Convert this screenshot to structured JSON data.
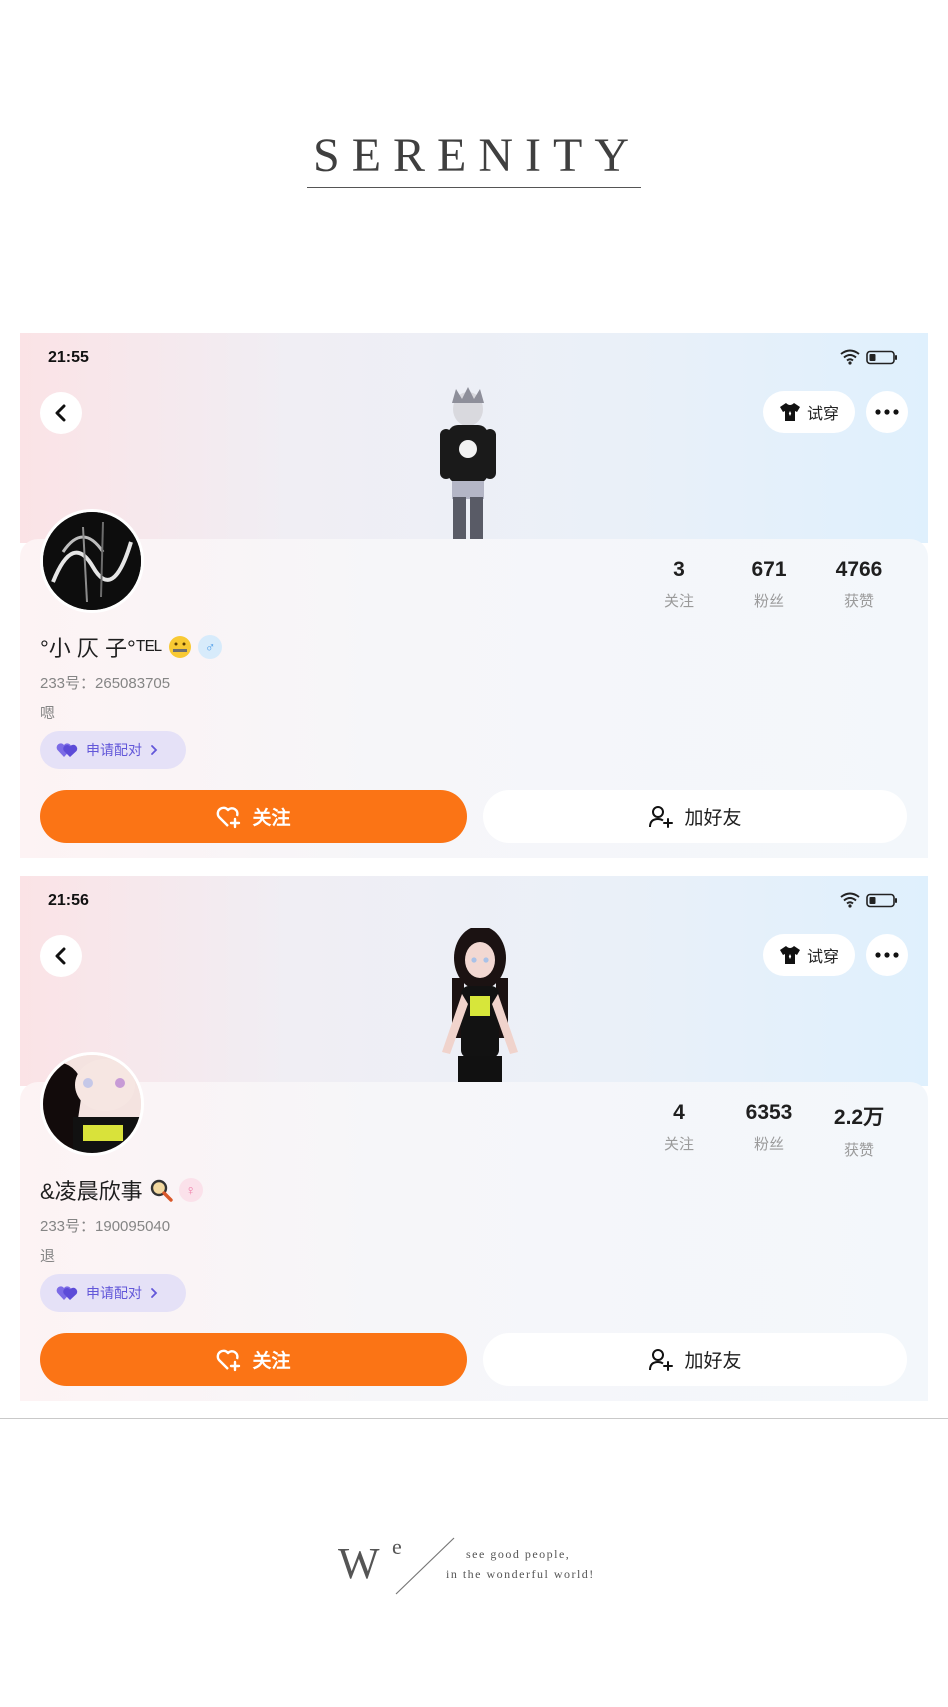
{
  "header_title": "SERENITY",
  "profiles": [
    {
      "status_time": "21:55",
      "tryon_label": "试穿",
      "stats": [
        {
          "value": "3",
          "label": "关注"
        },
        {
          "value": "671",
          "label": "粉丝"
        },
        {
          "value": "4766",
          "label": "获赞"
        }
      ],
      "username": "°小 仄 子°ᵀᴱᴸ",
      "gender": "♂",
      "account_id": "233号：265083705",
      "bio": "嗯",
      "pair_label": "申请配对",
      "follow_label": "关注",
      "add_friend_label": "加好友"
    },
    {
      "status_time": "21:56",
      "tryon_label": "试穿",
      "stats": [
        {
          "value": "4",
          "label": "关注"
        },
        {
          "value": "6353",
          "label": "粉丝"
        },
        {
          "value": "2.2万",
          "label": "获赞"
        }
      ],
      "username": "&凌晨欣事",
      "gender": "♀",
      "account_id": "233号：190095040",
      "bio": "退",
      "pair_label": "申请配对",
      "follow_label": "关注",
      "add_friend_label": "加好友"
    }
  ],
  "footer": {
    "letter_w": "W",
    "letter_e": "e",
    "line1": "see good people,",
    "line2": "in the wonderful world!"
  },
  "colors": {
    "accent_orange": "#fb7415",
    "pair_purple": "#6257d9",
    "male_blue": "#4a9be8",
    "female_pink": "#f07aa6"
  },
  "icons": [
    "wifi-icon",
    "battery-icon",
    "back-arrow-icon",
    "shirt-icon",
    "more-dots-icon",
    "heart-plus-icon",
    "add-user-icon",
    "double-heart-icon",
    "chevron-right-icon"
  ]
}
